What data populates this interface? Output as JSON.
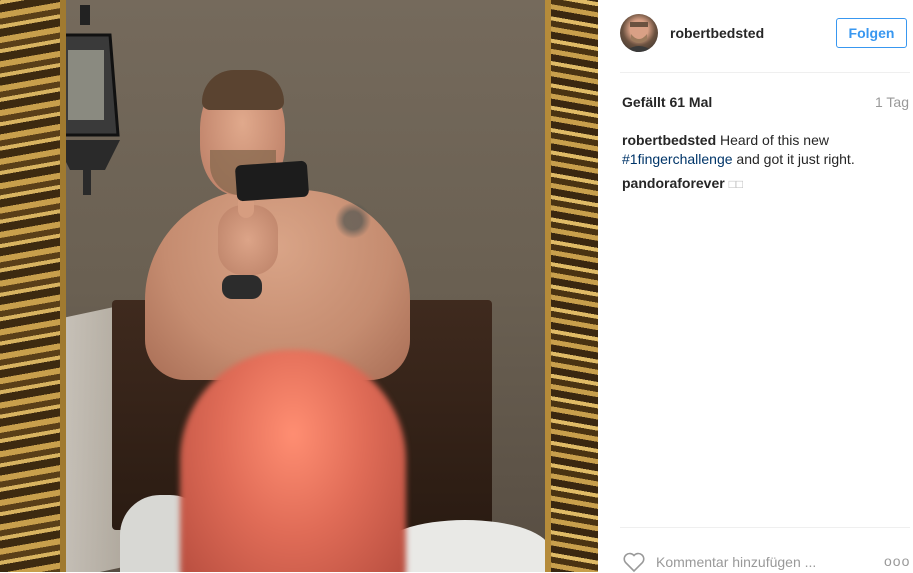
{
  "post": {
    "image_alt": "Selfie in a mirror",
    "user": {
      "username": "robertbedsted",
      "avatar_icon": "user-avatar"
    },
    "follow_label": "Folgen",
    "likes_text": "Gefällt 61 Mal",
    "time_ago": "1 Tag",
    "caption": {
      "username": "robertbedsted",
      "text_before": "Heard of this new",
      "hashtag": "#1fingerchallenge",
      "text_after": "and got it just right."
    },
    "comments": [
      {
        "username": "pandoraforever",
        "text": "□□"
      }
    ],
    "comment_placeholder": "Kommentar hinzufügen ...",
    "more_label": "ooo"
  },
  "colors": {
    "accent": "#3897f0",
    "hashtag": "#003569",
    "muted": "#999999",
    "text": "#262626"
  },
  "icons": {
    "like": "heart-icon",
    "more": "more-options-icon"
  }
}
